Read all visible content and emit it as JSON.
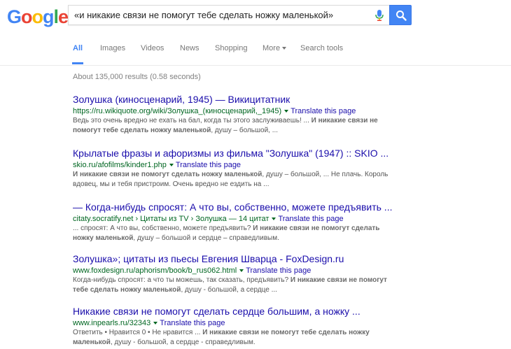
{
  "header": {
    "logo_letters": [
      {
        "char": "G",
        "color": "#4285f4"
      },
      {
        "char": "o",
        "color": "#ea4335"
      },
      {
        "char": "o",
        "color": "#fbbc05"
      },
      {
        "char": "g",
        "color": "#4285f4"
      },
      {
        "char": "l",
        "color": "#34a853"
      },
      {
        "char": "e",
        "color": "#ea4335"
      }
    ],
    "query": "«и никакие связи не помогут тебе сделать ножку маленькой»",
    "mic_icon": "microphone-icon",
    "search_icon": "magnifier-icon",
    "accent": "#4285f4"
  },
  "nav": {
    "tabs": [
      "All",
      "Images",
      "Videos",
      "News",
      "Shopping",
      "More",
      "Search tools"
    ]
  },
  "stats": "About 135,000 results (0.58 seconds)",
  "translate_label": "Translate this page",
  "results": [
    {
      "title": "Золушка (киносценарий, 1945) — Викицитатник",
      "url": "https://ru.wikiquote.org/wiki/Золушка_(киносценарий,_1945)",
      "snippet": [
        {
          "t": "Ведь это очень вредно не ехать на бал, когда ты этого заслуживаешь! ... ",
          "b": false
        },
        {
          "t": "И никакие связи не помогут тебе сделать ножку маленькой",
          "b": true
        },
        {
          "t": ", душу – большой, ...",
          "b": false
        }
      ]
    },
    {
      "title": "Крылатые фразы и афоризмы из фильма \"Золушка\" (1947) :: SKIO ...",
      "url": "skio.ru/afofilms/kinder1.php",
      "snippet": [
        {
          "t": "И никакие связи не помогут сделать ножку маленькой",
          "b": true
        },
        {
          "t": ", душу – большой, ... Не плачь. Король вдовец, мы и тебя пристроим. Очень вредно не ездить на ...",
          "b": false
        }
      ]
    },
    {
      "title": "— Когда-нибудь спросят: А что вы, собственно, можете предъявить ...",
      "url": "citaty.socratify.net › Цитаты из TV › Золушка — 14 цитат",
      "snippet": [
        {
          "t": "... спросят: А что вы, собственно, можете предъявить? ",
          "b": false
        },
        {
          "t": "И никакие связи не помогут сделать ножку маленькой",
          "b": true
        },
        {
          "t": ", душу – большой и сердце – справедливым.",
          "b": false
        }
      ]
    },
    {
      "title": "Золушка»; цитаты из пьесы Евгения Шварца - FoxDesign.ru",
      "url": "www.foxdesign.ru/aphorism/book/b_rus062.html",
      "snippet": [
        {
          "t": "Когда-нибудь спросят: а что ты можешь, так сказать, предъявить? ",
          "b": false
        },
        {
          "t": "И никакие связи не помогут тебе сделать ножку маленькой",
          "b": true
        },
        {
          "t": ", душу - большой, а сердце ...",
          "b": false
        }
      ]
    },
    {
      "title": "Никакие связи не помогут сделать сердце большим, а ножку ...",
      "url": "www.inpearls.ru/32343",
      "snippet": [
        {
          "t": "Ответить • Нравится 0 • Не нравится ... ",
          "b": false
        },
        {
          "t": "И никакие связи не помогут тебе сделать ножку маленькой",
          "b": true
        },
        {
          "t": ", душу - большой, а сердце - справедливым.",
          "b": false
        }
      ]
    }
  ]
}
